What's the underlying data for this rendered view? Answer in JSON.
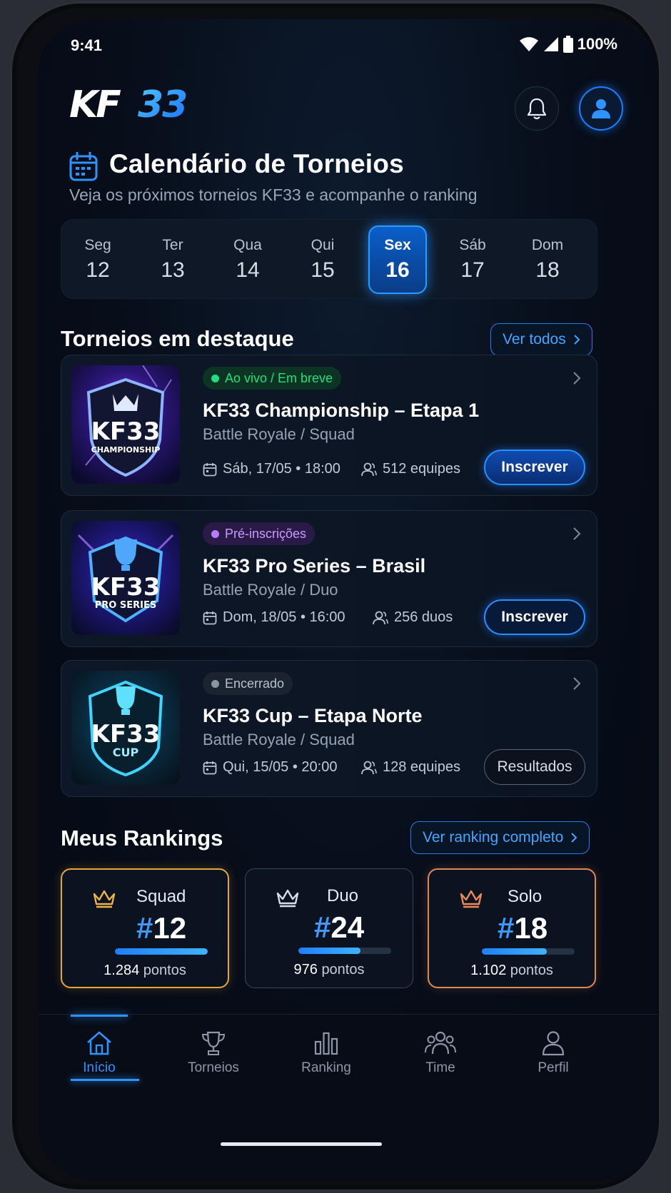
{
  "status_bar": {
    "time": "9:41",
    "battery": "100%"
  },
  "header": {
    "logo": "KF33",
    "icons": [
      "bell-icon",
      "user-icon"
    ]
  },
  "page": {
    "title": "Calendário de Torneios",
    "subtitle": "Veja os próximos torneios KF33 e acompanhe o ranking"
  },
  "days": [
    {
      "name": "Seg",
      "num": "12"
    },
    {
      "name": "Ter",
      "num": "13"
    },
    {
      "name": "Qua",
      "num": "14"
    },
    {
      "name": "Qui",
      "num": "15"
    },
    {
      "name": "Sex",
      "num": "16",
      "selected": true
    },
    {
      "name": "Sáb",
      "num": "17"
    },
    {
      "name": "Dom",
      "num": "18"
    }
  ],
  "featured": {
    "title": "Torneios em destaque",
    "see_all": "Ver todos",
    "cards": [
      {
        "status": "Ao vivo / Em breve",
        "status_color": "#1fe07a",
        "title": "KF33 Championship – Etapa 1",
        "mode": "Battle Royale / Squad",
        "date": "Sáb, 17/05 • 18:00",
        "teams": "512 equipes",
        "action": "Inscrever",
        "thumb_line1": "KF33",
        "thumb_line2": "CHAMPIONSHIP"
      },
      {
        "status": "Pré-inscrições",
        "status_color": "#b77cff",
        "title": "KF33 Pro Series – Brasil",
        "mode": "Battle Royale / Duo",
        "date": "Dom, 18/05 • 16:00",
        "teams": "256 duos",
        "action": "Inscrever",
        "thumb_line1": "KF33",
        "thumb_line2": "PRO SERIES"
      },
      {
        "status": "Encerrado",
        "status_color": "#8a94a3",
        "title": "KF33 Cup – Etapa Norte",
        "mode": "Battle Royale / Squad",
        "date": "Qui, 15/05 • 20:00",
        "teams": "128 equipes",
        "action": "Resultados",
        "thumb_line1": "KF33",
        "thumb_line2": "CUP"
      }
    ]
  },
  "rankings": {
    "title": "Meus Rankings",
    "see_all": "Ver ranking completo",
    "items": [
      {
        "label": "Squad",
        "hash": "#",
        "rank": "12",
        "points_num": "1.284",
        "points_word": "pontos",
        "progress": 1.0,
        "border": "#e5a53a"
      },
      {
        "label": "Duo",
        "hash": "#",
        "rank": "24",
        "points_num": "976",
        "points_word": "pontos",
        "progress": 0.67,
        "border": "#3b4658"
      },
      {
        "label": "Solo",
        "hash": "#",
        "rank": "18",
        "points_num": "1.102",
        "points_word": "pontos",
        "progress": 0.7,
        "border": "#e0875a"
      }
    ]
  },
  "tabbar": [
    {
      "label": "Início",
      "icon": "home-icon",
      "active": true
    },
    {
      "label": "Torneios",
      "icon": "trophy-icon"
    },
    {
      "label": "Ranking",
      "icon": "bar-chart-icon"
    },
    {
      "label": "Time",
      "icon": "team-icon"
    },
    {
      "label": "Perfil",
      "icon": "user-icon"
    }
  ]
}
